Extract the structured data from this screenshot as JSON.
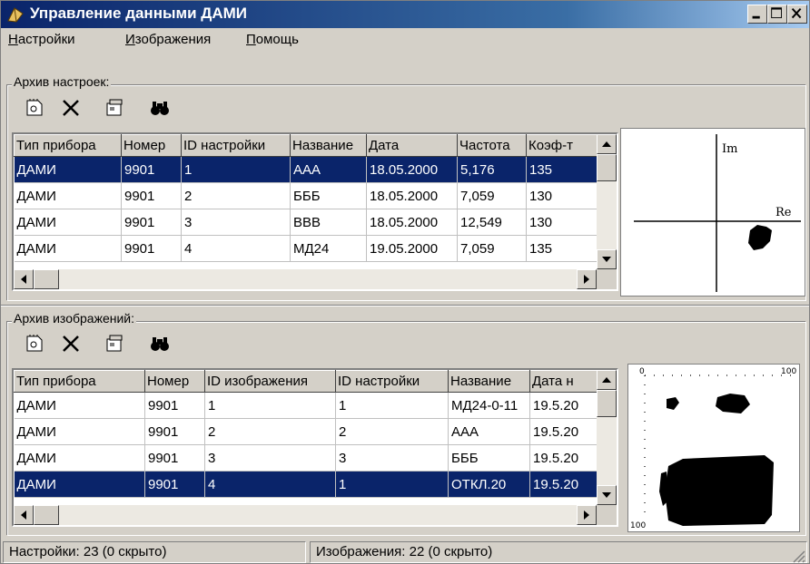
{
  "window": {
    "title": "Управление данными ДАМИ",
    "controls": [
      "minimize-icon",
      "maximize-icon",
      "close-icon"
    ]
  },
  "menu": [
    {
      "label_u": "Н",
      "label_rest": "астройки"
    },
    {
      "label_u": "И",
      "label_rest": "зображения"
    },
    {
      "label_u": "П",
      "label_rest": "омощь"
    }
  ],
  "settings_archive": {
    "label": "Архив настроек:",
    "toolbar": [
      "new-icon",
      "delete-icon",
      "properties-icon",
      "find-icon"
    ],
    "columns": [
      "Тип прибора",
      "Номер",
      "ID настройки",
      "Название",
      "Дата",
      "Частота",
      "Коэф-т"
    ],
    "rows": [
      [
        "ДАМИ",
        "9901",
        "1",
        "ААА",
        "18.05.2000",
        "5,176",
        "135"
      ],
      [
        "ДАМИ",
        "9901",
        "2",
        "БББ",
        "18.05.2000",
        "7,059",
        "130"
      ],
      [
        "ДАМИ",
        "9901",
        "3",
        "ВВВ",
        "18.05.2000",
        "12,549",
        "130"
      ],
      [
        "ДАМИ",
        "9901",
        "4",
        "МД24",
        "19.05.2000",
        "7,059",
        "135"
      ]
    ],
    "selected_row": 0,
    "preview": {
      "axis_im": "Im",
      "axis_re": "Re"
    }
  },
  "images_archive": {
    "label": "Архив изображений:",
    "toolbar": [
      "new-icon",
      "delete-icon",
      "properties-icon",
      "find-icon"
    ],
    "columns": [
      "Тип прибора",
      "Номер",
      "ID изображения",
      "ID настройки",
      "Название",
      "Дата н"
    ],
    "rows": [
      [
        "ДАМИ",
        "9901",
        "1",
        "1",
        "МД24-0-11",
        "19.5.20"
      ],
      [
        "ДАМИ",
        "9901",
        "2",
        "2",
        "ААА",
        "19.5.20"
      ],
      [
        "ДАМИ",
        "9901",
        "3",
        "3",
        "БББ",
        "19.5.20"
      ],
      [
        "ДАМИ",
        "9901",
        "4",
        "1",
        "ОТКЛ.20",
        "19.5.20"
      ]
    ],
    "selected_row": 3,
    "preview": {
      "scale_max": "100",
      "scale_origin": "0",
      "scale_left": "100"
    }
  },
  "status": {
    "settings": "Настройки: 23 (0 скрыто)",
    "images": "Изображения: 22 (0 скрыто)"
  },
  "colors": {
    "selection": "#0a246a",
    "face": "#d4d0c8",
    "title_start": "#0a246a"
  }
}
